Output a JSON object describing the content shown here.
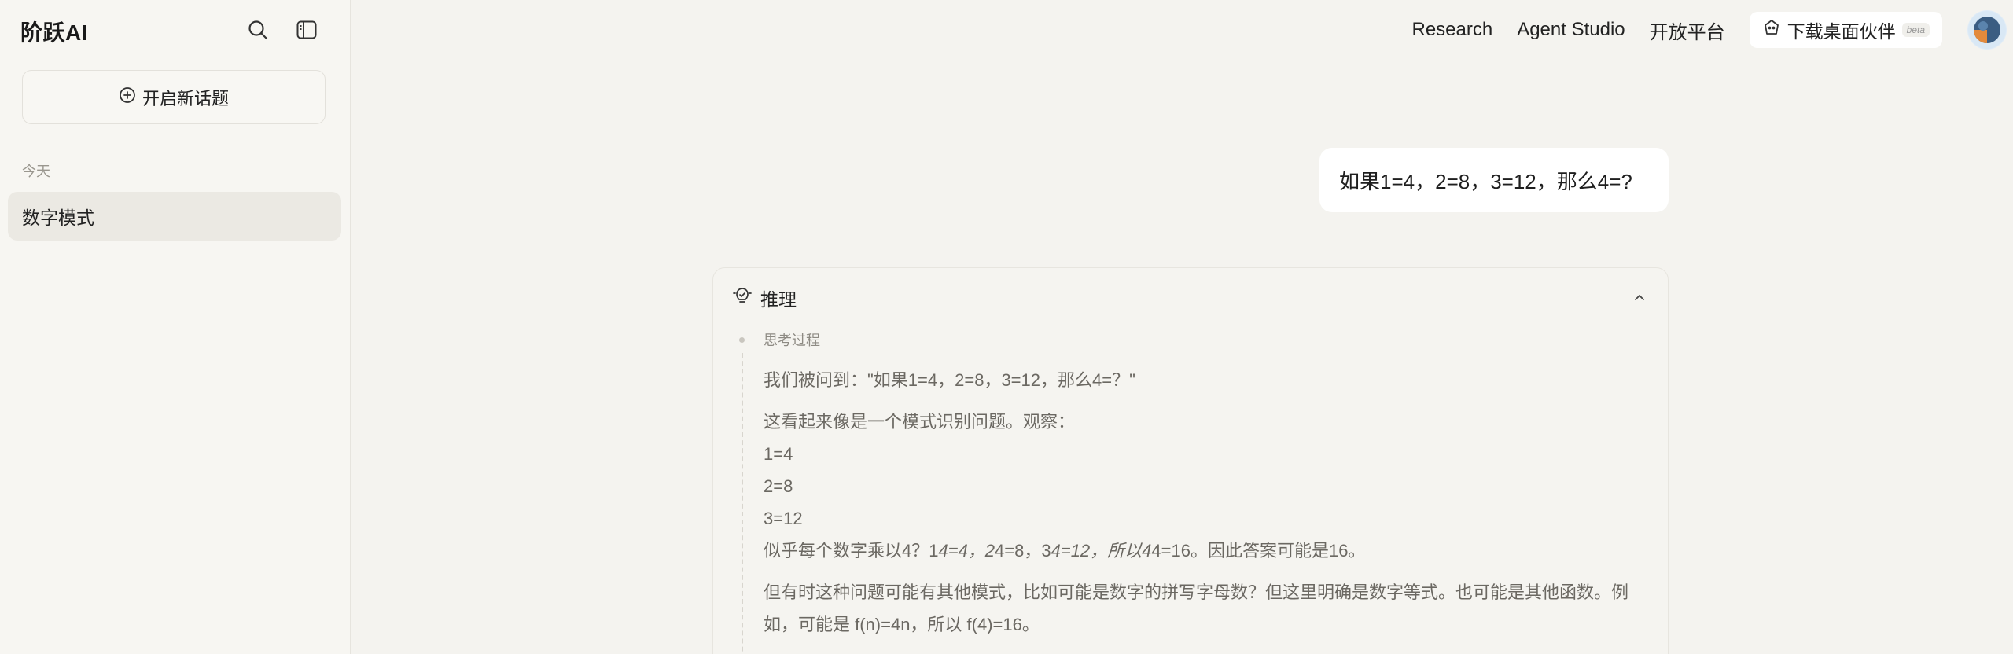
{
  "sidebar": {
    "logo": "阶跃AI",
    "new_topic_label": "开启新话题",
    "group_today": "今天",
    "history": [
      {
        "label": "数字模式"
      }
    ]
  },
  "topnav": {
    "links": [
      "Research",
      "Agent Studio",
      "开放平台"
    ],
    "download_label": "下载桌面伙伴",
    "beta_label": "beta"
  },
  "chat": {
    "user_message": "如果1=4，2=8，3=12，那么4=?",
    "reasoning": {
      "title": "推理",
      "thinking_label": "思考过程",
      "para1": "我们被问到：\"如果1=4，2=8，3=12，那么4=？\"",
      "para2_intro": "这看起来像是一个模式识别问题。观察：",
      "eq1": "1=4",
      "eq2": "2=8",
      "eq3": "3=12",
      "para2_conclusion_a": "似乎每个数字乘以4？1",
      "para2_conclusion_b": "4=4，2",
      "para2_conclusion_c": "4=8，3",
      "para2_conclusion_d": "4=12，所以4",
      "para2_conclusion_e": "4=16。因此答案可能是16。",
      "para3_line1": "但有时这种问题可能有其他模式，比如可能是数字的拼写字母数？但这里明确是数字等式。也可能是其他函数。例",
      "para3_line2": "如，可能是 f(n)=4n，所以 f(4)=16。"
    }
  },
  "colors": {
    "background": "#f4f3ef",
    "sidebar": "#f7f6f2",
    "selected_item": "#ebe9e3",
    "bubble": "#ffffff",
    "reason_text": "#6b6862"
  }
}
